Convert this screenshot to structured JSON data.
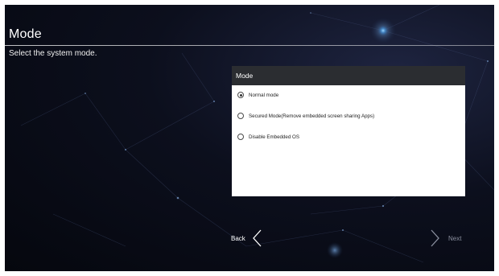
{
  "page": {
    "title": "Mode",
    "subtitle": "Select the system mode."
  },
  "dialog": {
    "header": "Mode",
    "options": [
      {
        "label": "Normal mode",
        "selected": true
      },
      {
        "label": "Secured Mode(Remove embedded screen sharing Apps)",
        "selected": false
      },
      {
        "label": "Disable Embedded OS",
        "selected": false
      }
    ]
  },
  "navigation": {
    "back_label": "Back",
    "back_icon": "chevron-left-icon",
    "next_label": "Next",
    "next_icon": "chevron-right-icon",
    "next_enabled": false
  },
  "colors": {
    "dialog_header": "#2b2d31",
    "background": "#0c0f1d",
    "next_disabled": "#8a8f9e"
  }
}
